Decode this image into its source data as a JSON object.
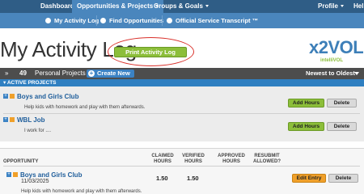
{
  "topnav": {
    "dashboard": "Dashboard",
    "opportunities": "Opportunities & Projects",
    "groups": "Groups & Goals",
    "profile": "Profile",
    "help": "Hel"
  },
  "subnav": {
    "activity_log": "My Activity Log",
    "find_opportunities": "Find Opportunities",
    "transcript": "Official Service Transcript ™"
  },
  "page": {
    "title": "My Activity Log",
    "print_button": "Print Activity Log"
  },
  "logo": {
    "main": "x2VOL",
    "sub": "intelliVOL"
  },
  "projects_bar": {
    "arrows": "»",
    "count": "49",
    "label": "Personal Projects",
    "create_button": "Create New",
    "sort": "Newest to Oldest"
  },
  "active_projects": {
    "header": "ACTIVE PROJECTS",
    "items": [
      {
        "name": "Boys and Girls Club",
        "description": "Help kids with homework and play with them afterwards.",
        "add_label": "Add Hours",
        "delete_label": "Delete"
      },
      {
        "name": "WBL Job",
        "description": "I work for ....",
        "add_label": "Add Hours",
        "delete_label": "Delete"
      }
    ]
  },
  "opportunities": {
    "headers": {
      "opportunity": "OPPORTUNITY",
      "claimed": "CLAIMED",
      "claimed2": "HOURS",
      "verified": "VERIFIED",
      "verified2": "HOURS",
      "approved": "APPROVED",
      "approved2": "HOURS",
      "resubmit": "RESUBMIT",
      "resubmit2": "ALLOWED?"
    },
    "rows": [
      {
        "name": "Boys and Girls Club",
        "date": "11/03/2025",
        "claimed": "1.50",
        "verified": "1.50",
        "description": "Help kids with homework and play with them afterwards.",
        "edit_label": "Edit Entry",
        "delete_label": "Delete"
      }
    ]
  },
  "colors": {
    "nav_dark": "#2f5d86",
    "nav_light": "#4a86bd",
    "green": "#8cbe3a",
    "orange": "#f0a02a",
    "highlight_circle": "#d9302a"
  }
}
